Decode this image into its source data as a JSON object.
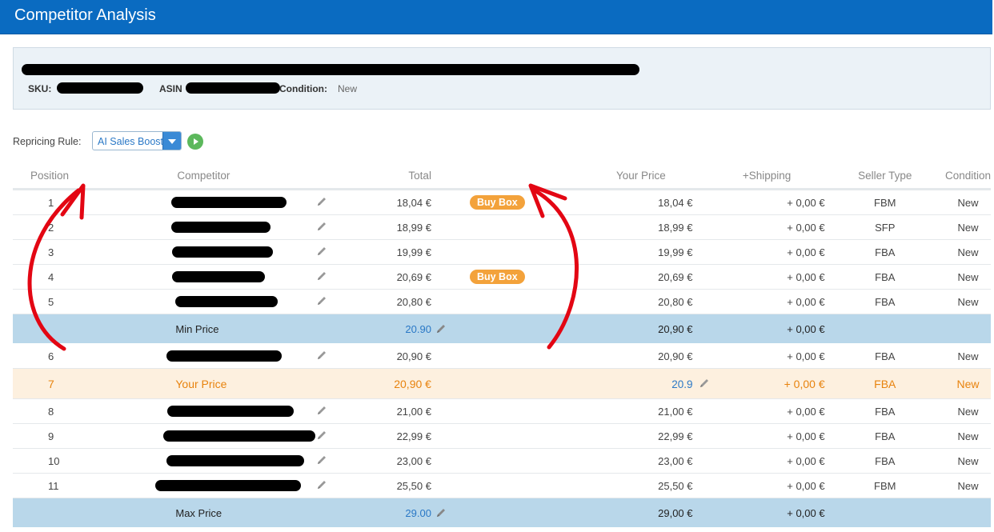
{
  "header": {
    "title": "Competitor Analysis"
  },
  "product": {
    "sku_label": "SKU:",
    "asin_label": "ASIN",
    "condition_label": "Condition:",
    "condition_value": "New"
  },
  "repricing": {
    "label": "Repricing Rule:",
    "selected": "AI Sales Boost"
  },
  "table": {
    "headers": [
      "Position",
      "Competitor",
      "Total",
      "Your Price",
      "+Shipping",
      "Seller Type",
      "Condition"
    ],
    "rows": [
      {
        "position": "1",
        "total": "18,04 €",
        "badge": "Buy Box",
        "your_price": "18,04 €",
        "shipping": "+ 0,00 €",
        "seller_type": "FBM",
        "condition": "New"
      },
      {
        "position": "2",
        "total": "18,99 €",
        "badge": "",
        "your_price": "18,99 €",
        "shipping": "+ 0,00 €",
        "seller_type": "SFP",
        "condition": "New"
      },
      {
        "position": "3",
        "total": "19,99 €",
        "badge": "",
        "your_price": "19,99 €",
        "shipping": "+ 0,00 €",
        "seller_type": "FBA",
        "condition": "New"
      },
      {
        "position": "4",
        "total": "20,69 €",
        "badge": "Buy Box",
        "your_price": "20,69 €",
        "shipping": "+ 0,00 €",
        "seller_type": "FBA",
        "condition": "New"
      },
      {
        "position": "5",
        "total": "20,80 €",
        "badge": "",
        "your_price": "20,80 €",
        "shipping": "+ 0,00 €",
        "seller_type": "FBA",
        "condition": "New"
      }
    ],
    "min_price": {
      "label": "Min Price",
      "total": "20.90",
      "your_price": "20,90 €",
      "shipping": "+ 0,00 €"
    },
    "row6": {
      "position": "6",
      "total": "20,90 €",
      "your_price": "20,90 €",
      "shipping": "+ 0,00 €",
      "seller_type": "FBA",
      "condition": "New"
    },
    "your_row": {
      "position": "7",
      "label": "Your Price",
      "total": "20,90 €",
      "your_price": "20.9",
      "shipping": "+ 0,00 €",
      "seller_type": "FBA",
      "condition": "New"
    },
    "rows_after": [
      {
        "position": "8",
        "total": "21,00 €",
        "your_price": "21,00 €",
        "shipping": "+ 0,00 €",
        "seller_type": "FBA",
        "condition": "New"
      },
      {
        "position": "9",
        "total": "22,99 €",
        "your_price": "22,99 €",
        "shipping": "+ 0,00 €",
        "seller_type": "FBA",
        "condition": "New"
      },
      {
        "position": "10",
        "total": "23,00 €",
        "your_price": "23,00 €",
        "shipping": "+ 0,00 €",
        "seller_type": "FBA",
        "condition": "New"
      },
      {
        "position": "11",
        "total": "25,50 €",
        "your_price": "25,50 €",
        "shipping": "+ 0,00 €",
        "seller_type": "FBM",
        "condition": "New"
      }
    ],
    "max_price": {
      "label": "Max Price",
      "total": "29.00",
      "your_price": "29,00 €",
      "shipping": "+ 0,00 €"
    }
  },
  "colors": {
    "header": "#0a6bc1",
    "badge": "#f3a23b",
    "minmax_row": "#b9d7ea",
    "your_row": "#fdf0df",
    "arrow": "#e30613"
  }
}
